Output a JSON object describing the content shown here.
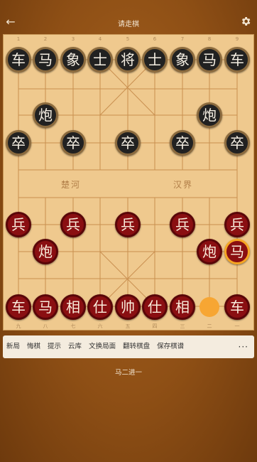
{
  "header": {
    "title": "请走棋",
    "back_icon": "←"
  },
  "board": {
    "top_numbers": [
      "1",
      "2",
      "3",
      "4",
      "5",
      "6",
      "7",
      "8",
      "9"
    ],
    "bottom_numbers": [
      "九",
      "八",
      "七",
      "六",
      "五",
      "四",
      "三",
      "二",
      "一"
    ],
    "river_left": "楚河",
    "river_right": "汉界"
  },
  "pieces": {
    "black_back_rank": [
      "车",
      "马",
      "象",
      "士",
      "将",
      "士",
      "象",
      "马",
      "车"
    ],
    "black_cannon_left": "炮",
    "black_cannon_right": "炮",
    "black_soldiers": [
      "卒",
      "卒",
      "卒",
      "卒",
      "卒"
    ],
    "red_soldiers": [
      "兵",
      "兵",
      "兵",
      "兵",
      "兵"
    ],
    "red_cannon_left": "炮",
    "red_cannon_right": "炮",
    "red_horse_moved": "马",
    "red_back_rank": [
      "车",
      "马",
      "相",
      "仕",
      "帅",
      "仕",
      "相",
      "车"
    ]
  },
  "toolbar": {
    "buttons": [
      "新局",
      "悔棋",
      "提示",
      "云库",
      "文换局面",
      "翻转棋盘",
      "保存棋谱"
    ],
    "more": "···"
  },
  "status": {
    "last_move": "马二进一"
  },
  "colors": {
    "board": "#efc98e",
    "lines": "#c98f4f",
    "red_piece": "#8a0f12",
    "black_piece": "#212121",
    "highlight": "#f7a633"
  }
}
